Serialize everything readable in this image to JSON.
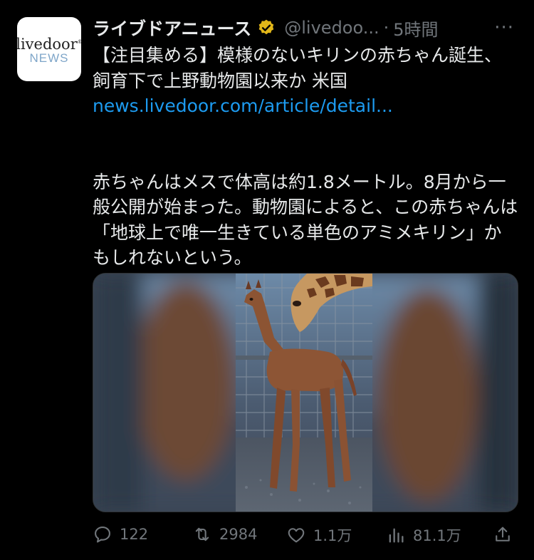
{
  "account": {
    "avatar_line1": "livedoor",
    "avatar_line2": "NEWS",
    "display_name": "ライブドアニュース",
    "handle": "@livedoo...",
    "separator": "·",
    "time": "5時間"
  },
  "tweet": {
    "headline": "【注目集める】模様のないキリンの赤ちゃん誕生、飼育下で上野動物園以来か 米国",
    "link": "news.livedoor.com/article/detail...",
    "body": "赤ちゃんはメスで体高は約1.8メートル。8月から一般公開が始まった。動物園によると、この赤ちゃんは「地球上で唯一生きている単色のアミメキリン」かもしれないという。"
  },
  "actions": {
    "replies": "122",
    "retweets": "2984",
    "likes": "1.1万",
    "views": "81.1万"
  },
  "icons": [
    "verified-badge-icon",
    "more-icon",
    "reply-icon",
    "retweet-icon",
    "like-icon",
    "views-icon",
    "share-icon"
  ],
  "colors": {
    "background": "#000000",
    "text": "#e7e9ea",
    "muted": "#71767b",
    "link": "#1d9bf0",
    "verified": "#e2b719"
  }
}
